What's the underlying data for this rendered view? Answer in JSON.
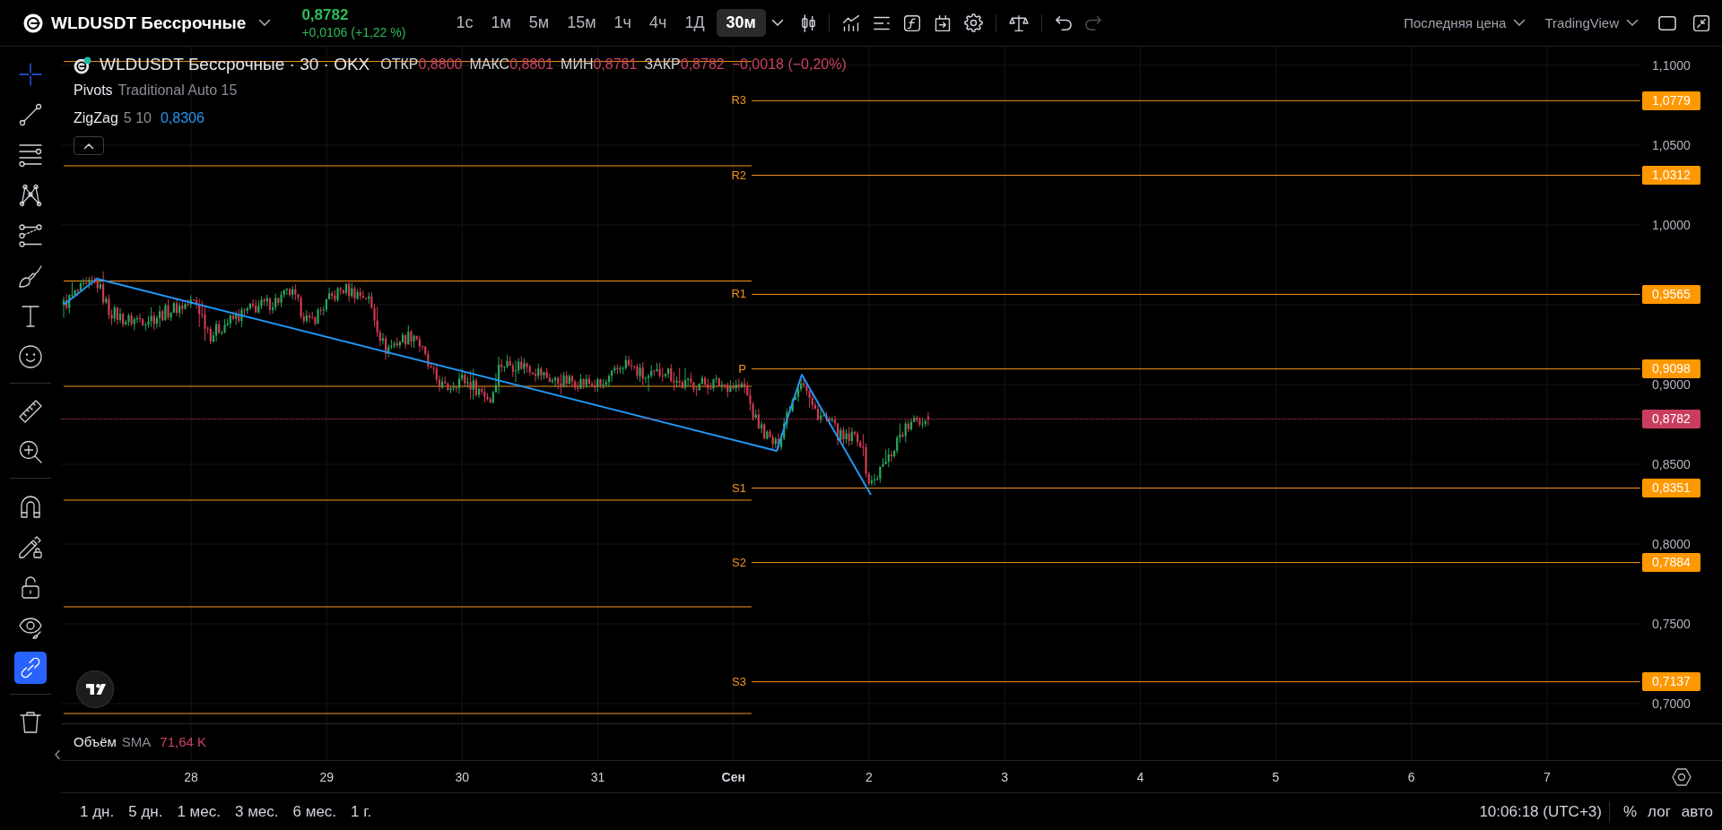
{
  "top_bar": {
    "symbol": "WLDUSDT Бессрочные",
    "last_price": "0,8782",
    "change": "+0,0106 (+1,22 %)",
    "intervals": [
      {
        "label": "1с",
        "selected": false
      },
      {
        "label": "1м",
        "selected": false
      },
      {
        "label": "5м",
        "selected": false
      },
      {
        "label": "15м",
        "selected": false
      },
      {
        "label": "1ч",
        "selected": false
      },
      {
        "label": "4ч",
        "selected": false
      },
      {
        "label": "1Д",
        "selected": false
      },
      {
        "label": "30м",
        "selected": true
      }
    ],
    "undo": {
      "disabled": false
    },
    "redo": {
      "disabled": true
    },
    "price_source": "Последняя цена",
    "layout": "TradingView"
  },
  "drawing_tools": [
    {
      "selected": true
    },
    {
      "selected": false
    },
    {
      "selected": false
    },
    {
      "selected": false
    },
    {
      "selected": false
    },
    {
      "selected": false
    },
    {
      "selected": false
    },
    {
      "selected": false
    },
    {
      "selected": false
    },
    {
      "selected": false
    }
  ],
  "toggles": [
    {
      "on": false
    },
    {
      "on": false
    },
    {
      "on": false
    },
    {
      "on": false
    },
    {
      "on": true
    }
  ],
  "legend": {
    "title": "WLDUSDT Бессрочные · 30 · OKX",
    "ohlc": [
      {
        "label": "ОТКР",
        "value": "0,8800"
      },
      {
        "label": "МАКС",
        "value": "0,8801"
      },
      {
        "label": "МИН",
        "value": "0,8781"
      },
      {
        "label": "ЗАКР",
        "value": "0,8782"
      }
    ],
    "change": "−0,0018 (−0,20%)"
  },
  "indicators": [
    {
      "name": "Pivots",
      "params": "Traditional Auto 15"
    },
    {
      "name": "ZigZag",
      "params": "5 10",
      "value": "0,8306"
    }
  ],
  "pivot_levels": [
    {
      "label": "R3",
      "value": "1,0779"
    },
    {
      "label": "R2",
      "value": "1,0312"
    },
    {
      "label": "R1",
      "value": "0,9565"
    },
    {
      "label": "P",
      "value": "0,9098"
    },
    {
      "label": "S1",
      "value": "0,8351"
    },
    {
      "label": "S2",
      "value": "0,7884"
    },
    {
      "label": "S3",
      "value": "0,7137"
    }
  ],
  "price_axis": {
    "labels": [
      "1,1000",
      "1,0500",
      "1,0000",
      "0,9000",
      "0,8500",
      "0,8000",
      "0,7500",
      "0,7000"
    ],
    "last_price": "0,8782"
  },
  "volume_legend": {
    "name": "Объём",
    "ma": "SMA",
    "value": "71,64 K"
  },
  "time_axis": [
    {
      "label": "28",
      "kind": "day"
    },
    {
      "label": "29",
      "kind": "day"
    },
    {
      "label": "30",
      "kind": "day"
    },
    {
      "label": "31",
      "kind": "day"
    },
    {
      "label": "Сен",
      "kind": "month"
    },
    {
      "label": "2",
      "kind": "day"
    },
    {
      "label": "3",
      "kind": "day"
    },
    {
      "label": "4",
      "kind": "day"
    },
    {
      "label": "5",
      "kind": "day"
    },
    {
      "label": "6",
      "kind": "day"
    },
    {
      "label": "7",
      "kind": "day"
    }
  ],
  "bottom_bar": {
    "ranges": [
      "1 дн.",
      "5 дн.",
      "1 мес.",
      "3 мес.",
      "6 мес.",
      "1 г."
    ],
    "clock": "10:06:18 (UTC+3)",
    "scale_options": [
      "%",
      "лог",
      "авто"
    ]
  }
}
